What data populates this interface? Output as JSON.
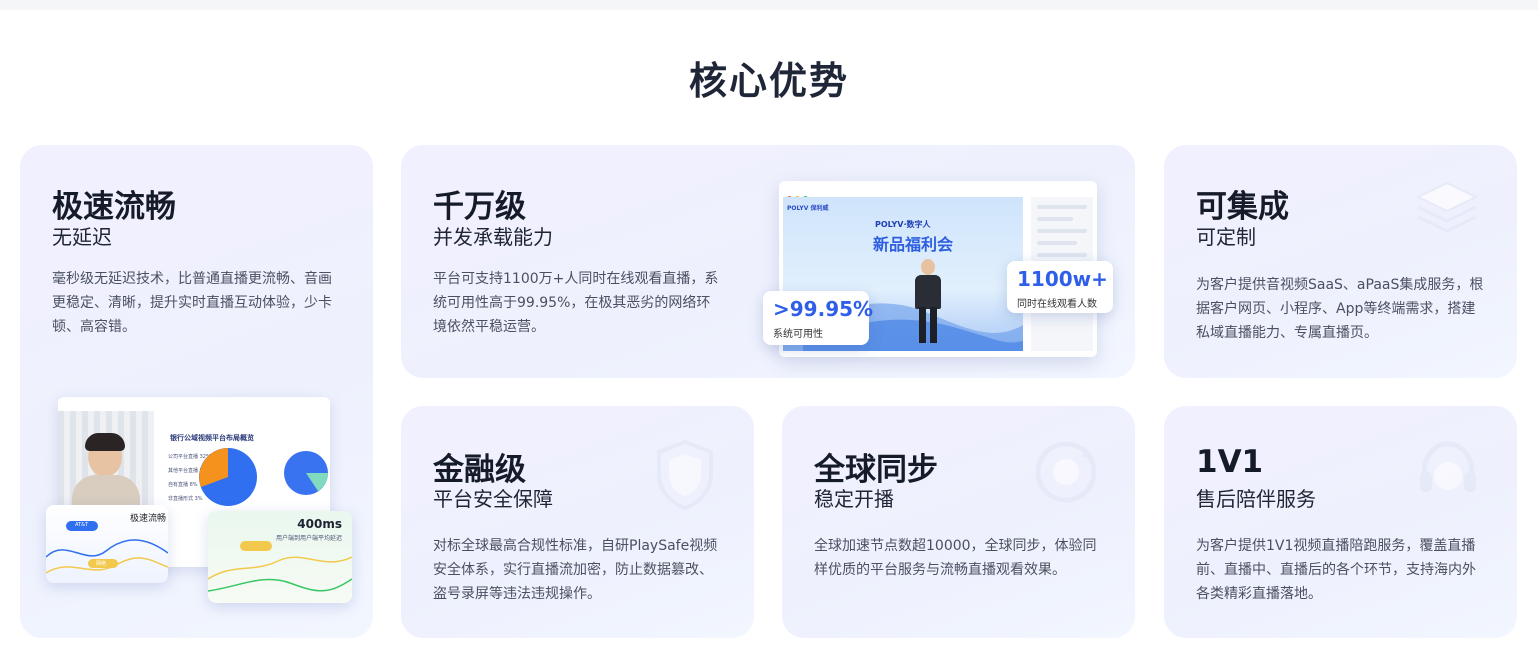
{
  "section": {
    "title": "核心优势"
  },
  "cards": [
    {
      "title": "极速流畅",
      "subtitle": "无延迟",
      "desc": "毫秒级无延迟技术，比普通直播更流畅、音画更稳定、清晰，提升实时直播互动体验，少卡顿、高容错。"
    },
    {
      "title": "千万级",
      "subtitle": "并发承载能力",
      "desc": "平台可支持1100万+人同时在线观看直播，系统可用性高于99.95%，在极其恶劣的网络环境依然平稳运营。"
    },
    {
      "title": "可集成",
      "subtitle": "可定制",
      "desc": "为客户提供音视频SaaS、aPaaS集成服务，根据客户网页、小程序、App等终端需求，搭建私域直播能力、专属直播页。"
    },
    {
      "title": "金融级",
      "subtitle": "平台安全保障",
      "desc": "对标全球最高合规性标准，自研PlaySafe视频安全体系，实行直播流加密，防止数据篡改、盗号录屏等违法违规操作。"
    },
    {
      "title": "全球同步",
      "subtitle": "稳定开播",
      "desc": "全球加速节点数超10000，全球同步，体验同样优质的平台服务与流畅直播观看效果。"
    },
    {
      "title": "1V1",
      "subtitle": "售后陪伴服务",
      "desc": "为客户提供1V1视频直播陪跑服务，覆盖直播前、直播中、直播后的各个环节，支持海内外各类精彩直播落地。"
    }
  ],
  "illus1": {
    "chart_title": "银行公域视频平台布局概览",
    "mini_left_title": "极速流畅",
    "pill_a": "AT&T",
    "pill_b": "网络",
    "latency_value": "400ms",
    "latency_label": "用户端到用户端平均延迟",
    "legend_a": "公司平台直播 32%",
    "legend_b": "其他平台直播 57%",
    "legend_c": "自有直播 8%",
    "legend_d": "非直播形式 3%"
  },
  "illus2": {
    "brand": "POLYV 保利威",
    "event_tag": "POLYV·数字人",
    "event_title": "新品福利会",
    "viewers_value": "1100w+",
    "viewers_label": "同时在线观看人数",
    "uptime_value": ">99.95%",
    "uptime_label": "系统可用性"
  },
  "colors": {
    "accent": "#2f5fe8",
    "orange": "#f5921e",
    "yellow": "#f2c94c",
    "green": "#38c764"
  }
}
